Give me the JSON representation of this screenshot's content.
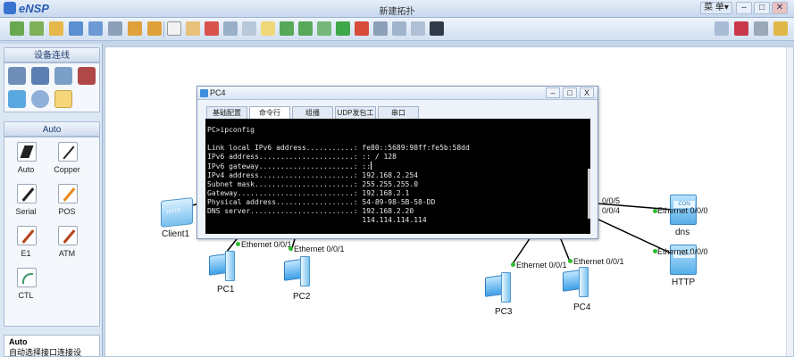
{
  "app": {
    "logo_text": "eNSP",
    "window_title": "新建拓扑",
    "menu_label": "菜 单▾",
    "win_controls": [
      "–",
      "□",
      "✕"
    ]
  },
  "left_panel": {
    "category_header": "设备连线",
    "auto_header": "Auto",
    "connections": [
      {
        "label": "Auto",
        "icon": "auto-link-icon",
        "color": "#222222"
      },
      {
        "label": "Copper",
        "icon": "copper-link-icon",
        "color": "#222222"
      },
      {
        "label": "Serial",
        "icon": "serial-link-icon",
        "color": "#222222"
      },
      {
        "label": "POS",
        "icon": "pos-link-icon",
        "color": "#e98a1d"
      },
      {
        "label": "E1",
        "icon": "e1-link-icon",
        "color": "#b5421c"
      },
      {
        "label": "ATM",
        "icon": "atm-link-icon",
        "color": "#b5421c"
      },
      {
        "label": "CTL",
        "icon": "ctl-link-icon",
        "color": "#3a9a6a"
      }
    ],
    "description": {
      "title": "Auto",
      "text": "自动选择接口连接设"
    }
  },
  "canvas": {
    "devices": [
      {
        "label": "Client1",
        "type": "client"
      },
      {
        "label": "PC1",
        "type": "pc"
      },
      {
        "label": "PC2",
        "type": "pc"
      },
      {
        "label": "PC3",
        "type": "pc"
      },
      {
        "label": "PC4",
        "type": "pc"
      },
      {
        "label": "dns",
        "type": "server"
      },
      {
        "label": "HTTP",
        "type": "server"
      }
    ],
    "port_labels": [
      "Ethernet 0/0/1",
      "Ethernet 0/0/1",
      "Ethernet 0/0/1",
      "Ethernet 0/0/1",
      "0/0/5",
      "0/0/4",
      "Ethernet 0/0/0",
      "Ethernet 0/0/0"
    ]
  },
  "pc4_window": {
    "title": "PC4",
    "controls": [
      "–",
      "□",
      "X"
    ],
    "tabs": [
      "基础配置",
      "命令行",
      "组播",
      "UDP发包工具",
      "串口"
    ],
    "active_tab": "命令行",
    "terminal_lines": [
      "PC>ipconfig",
      "",
      "Link local IPv6 address...........: fe80::5689:98ff:fe5b:58dd",
      "IPv6 address......................: :: / 128",
      "IPv6 gateway......................: ::",
      "IPv4 address......................: 192.168.2.254",
      "Subnet mask.......................: 255.255.255.0",
      "Gateway...........................: 192.168.2.1",
      "Physical address..................: 54-89-98-5B-58-DD",
      "DNS server........................: 192.168.2.20",
      "                                    114.114.114.114"
    ]
  },
  "colors": {
    "link_green": "#2dbb2d",
    "accent_blue": "#3a74d0"
  }
}
